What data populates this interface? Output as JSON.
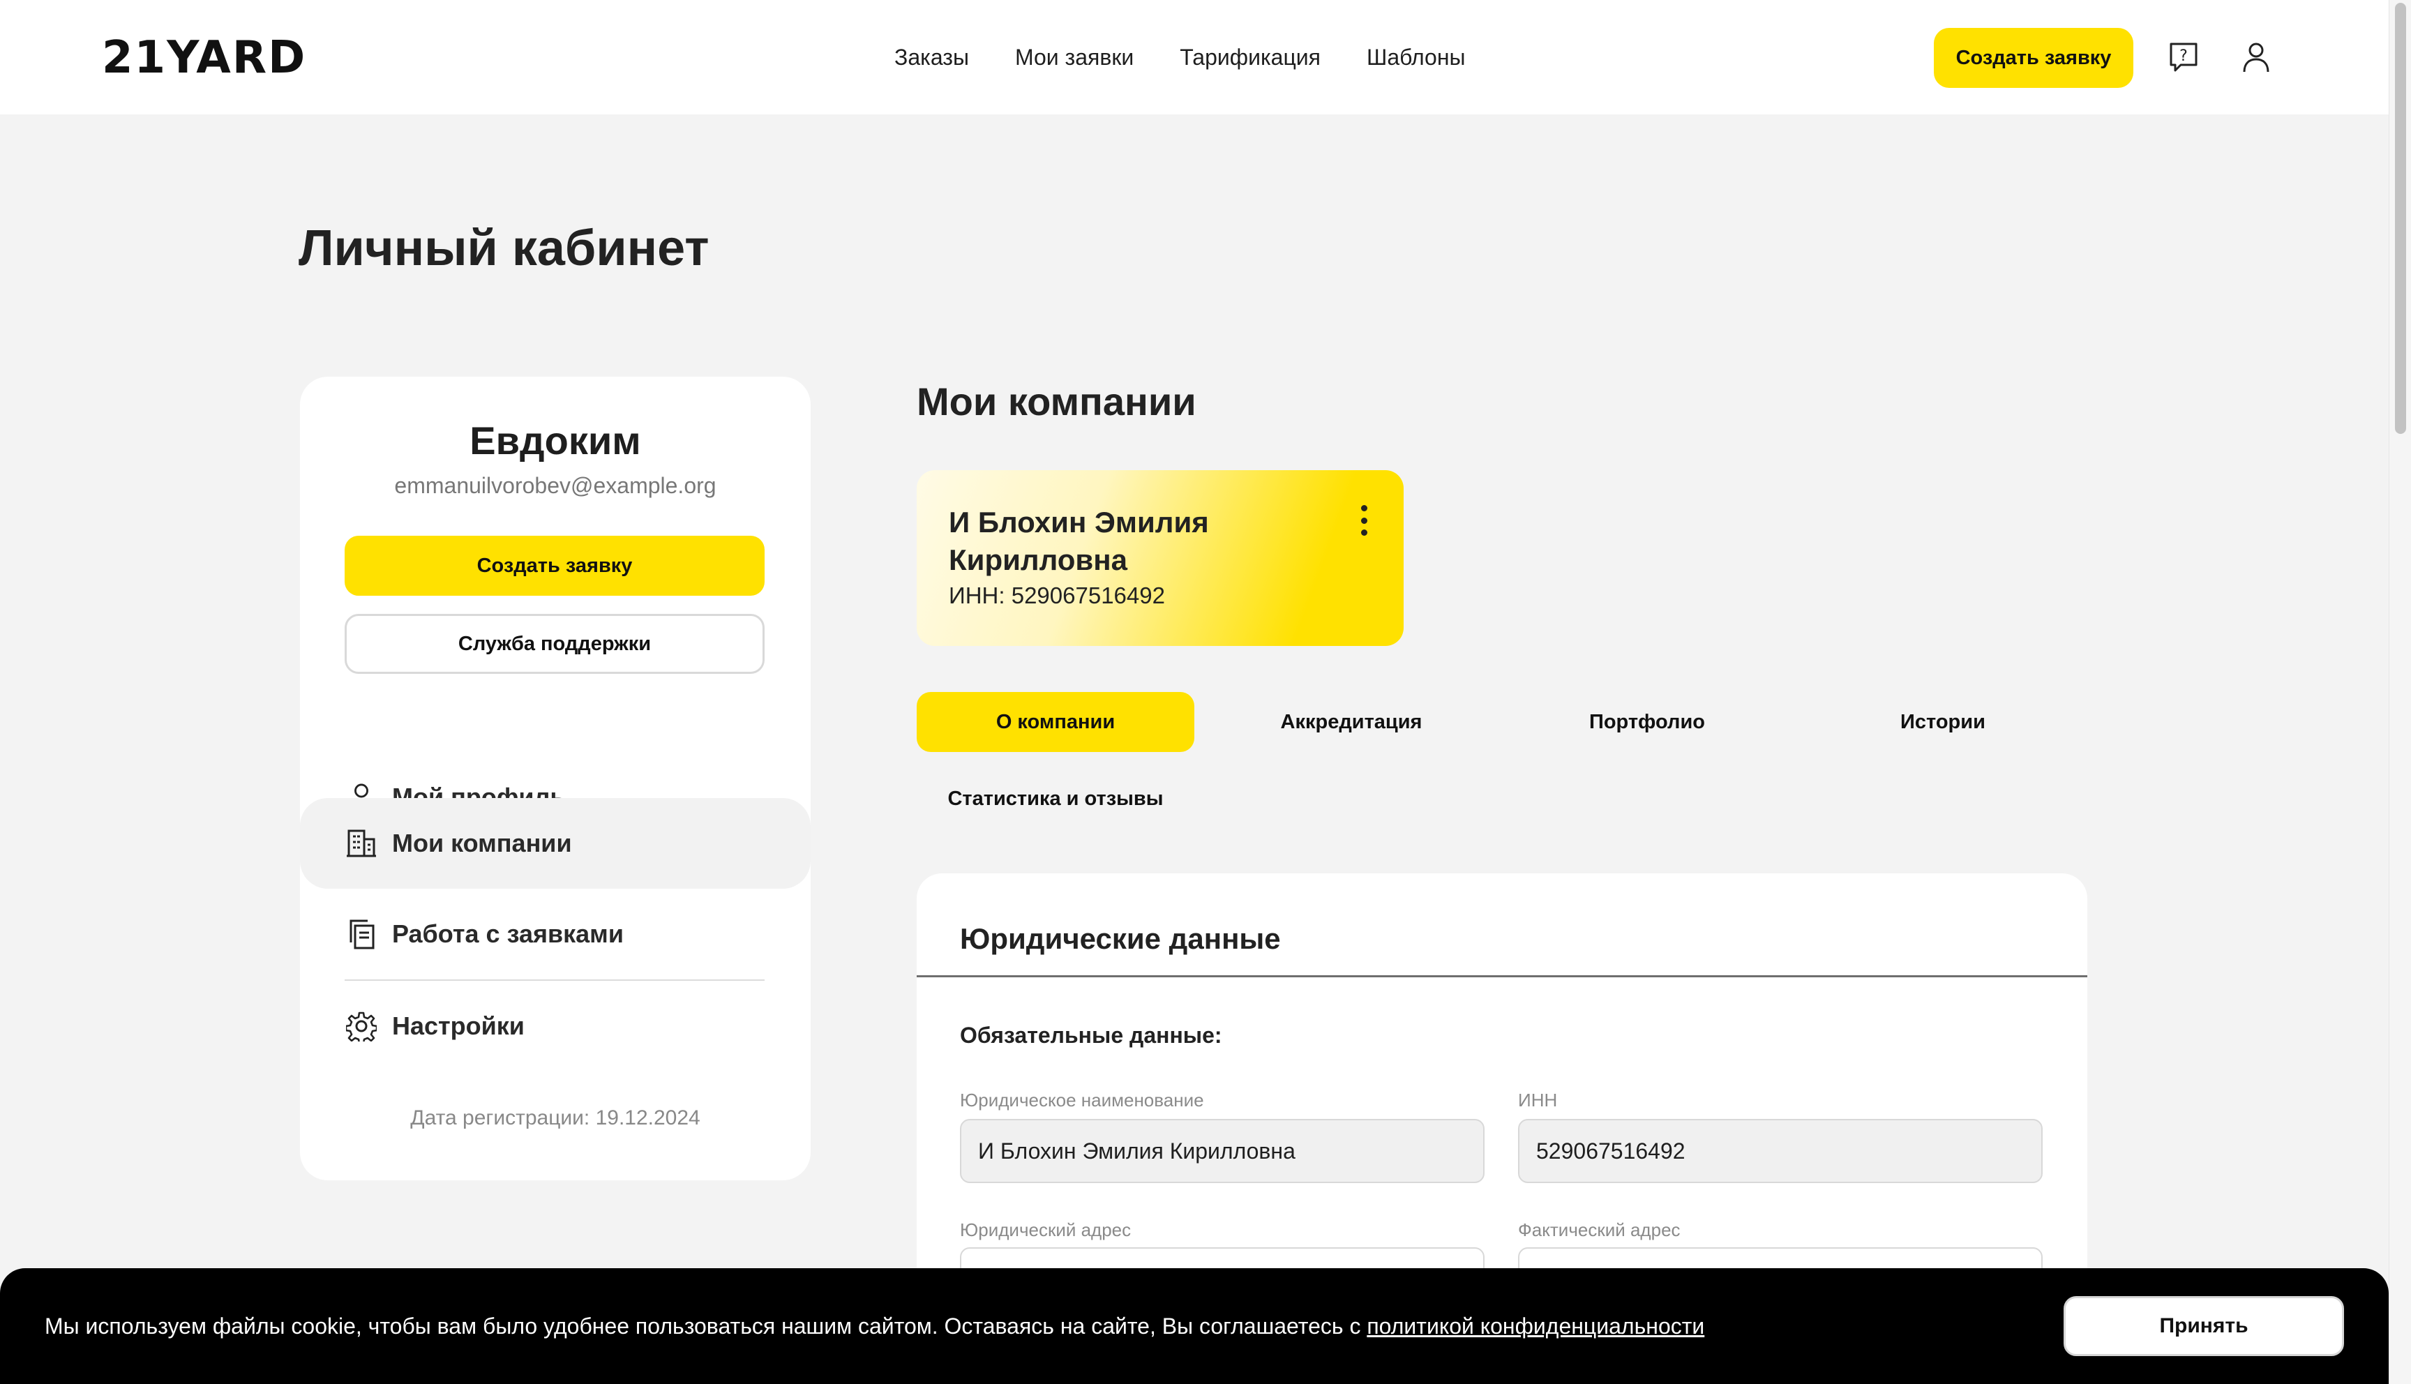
{
  "header": {
    "logo": "21YARD",
    "nav": [
      "Заказы",
      "Мои заявки",
      "Тарификация",
      "Шаблоны"
    ],
    "create_button": "Создать заявку",
    "icons": [
      "help-icon",
      "user-icon"
    ]
  },
  "page_title": "Личный кабинет",
  "sidebar": {
    "name": "Евдоким",
    "email": "emmanuilvorobev@example.org",
    "create_button": "Создать заявку",
    "support_button": "Служба поддержки",
    "menu": [
      {
        "label": "Мой профиль",
        "icon": "user-icon"
      },
      {
        "label": "Мои компании",
        "icon": "building-icon"
      },
      {
        "label": "Работа с заявками",
        "icon": "documents-icon"
      },
      {
        "label": "Настройки",
        "icon": "gear-icon"
      }
    ],
    "active_item": "Мои компании",
    "registration": "Дата регистрации: 19.12.2024"
  },
  "main": {
    "title": "Мои компании",
    "company": {
      "name": "И Блохин Эмилия Кирилловна",
      "inn": "ИНН: 529067516492"
    },
    "tabs": [
      "О компании",
      "Аккредитация",
      "Портфолио",
      "Истории",
      "Статистика и отзывы"
    ],
    "active_tab": "О компании",
    "legal": {
      "title": "Юридические данные",
      "required_label": "Обязательные данные:",
      "fields": [
        {
          "label": "Юридическое наименование",
          "value": "И Блохин Эмилия Кирилловна"
        },
        {
          "label": "ИНН",
          "value": "529067516492"
        },
        {
          "label": "Юридический адрес",
          "value": ""
        },
        {
          "label": "Фактический адрес",
          "value": ""
        }
      ]
    }
  },
  "cookie": {
    "text": "Мы используем файлы cookie, чтобы вам было удобнее пользоваться нашим сайтом. Оставаясь на сайте, Вы соглашаетесь с ",
    "link": "политикой конфиденциальности",
    "accept": "Принять"
  },
  "colors": {
    "accent": "#ffe100",
    "background": "#f3f3f3",
    "card": "#ffffff",
    "cookie_bg": "#000000"
  }
}
